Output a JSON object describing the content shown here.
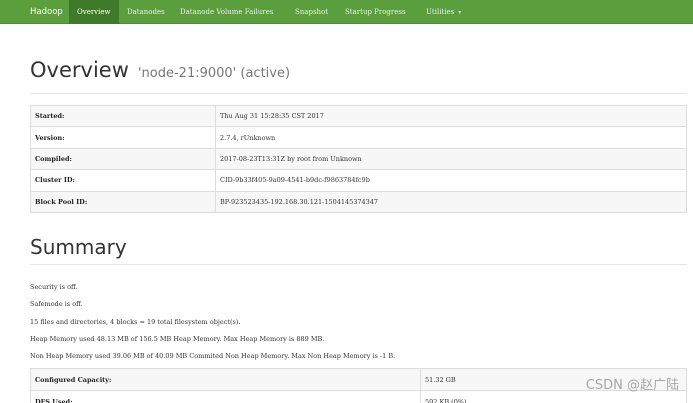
{
  "nav": {
    "brand": "Hadoop",
    "items": [
      {
        "label": "Overview"
      },
      {
        "label": "Datanodes"
      },
      {
        "label": "Datanode Volume Failures"
      },
      {
        "label": "Snapshot"
      },
      {
        "label": "Startup Progress"
      },
      {
        "label": "Utilities"
      }
    ]
  },
  "overview": {
    "title": "Overview",
    "subtitle": "'node-21:9000' (active)",
    "rows": [
      {
        "key": "Started:",
        "value": "Thu Aug 31 15:28:35 CST 2017"
      },
      {
        "key": "Version:",
        "value": "2.7.4, rUnknown"
      },
      {
        "key": "Compiled:",
        "value": "2017-08-23T13:31Z by root from Unknown"
      },
      {
        "key": "Cluster ID:",
        "value": "CID-9b33f405-9a09-4541-b9dc-f9863784fc9b"
      },
      {
        "key": "Block Pool ID:",
        "value": "BP-923523435-192.168.30.121-1504145374347"
      }
    ]
  },
  "summary": {
    "title": "Summary",
    "lines": [
      "Security is off.",
      "Safemode is off.",
      "15 files and directories, 4 blocks = 19 total filesystem object(s).",
      "Heap Memory used 48.13 MB of 156.5 MB Heap Memory. Max Heap Memory is 889 MB.",
      "Non Heap Memory used 39.06 MB of 40.09 MB Commited Non Heap Memory. Max Non Heap Memory is -1 B."
    ],
    "capacity_rows": [
      {
        "key": "Configured Capacity:",
        "value": "51.32 GB"
      },
      {
        "key": "DFS Used:",
        "value": "592 KB (0%)"
      }
    ]
  },
  "watermark": "CSDN @赵广陆"
}
